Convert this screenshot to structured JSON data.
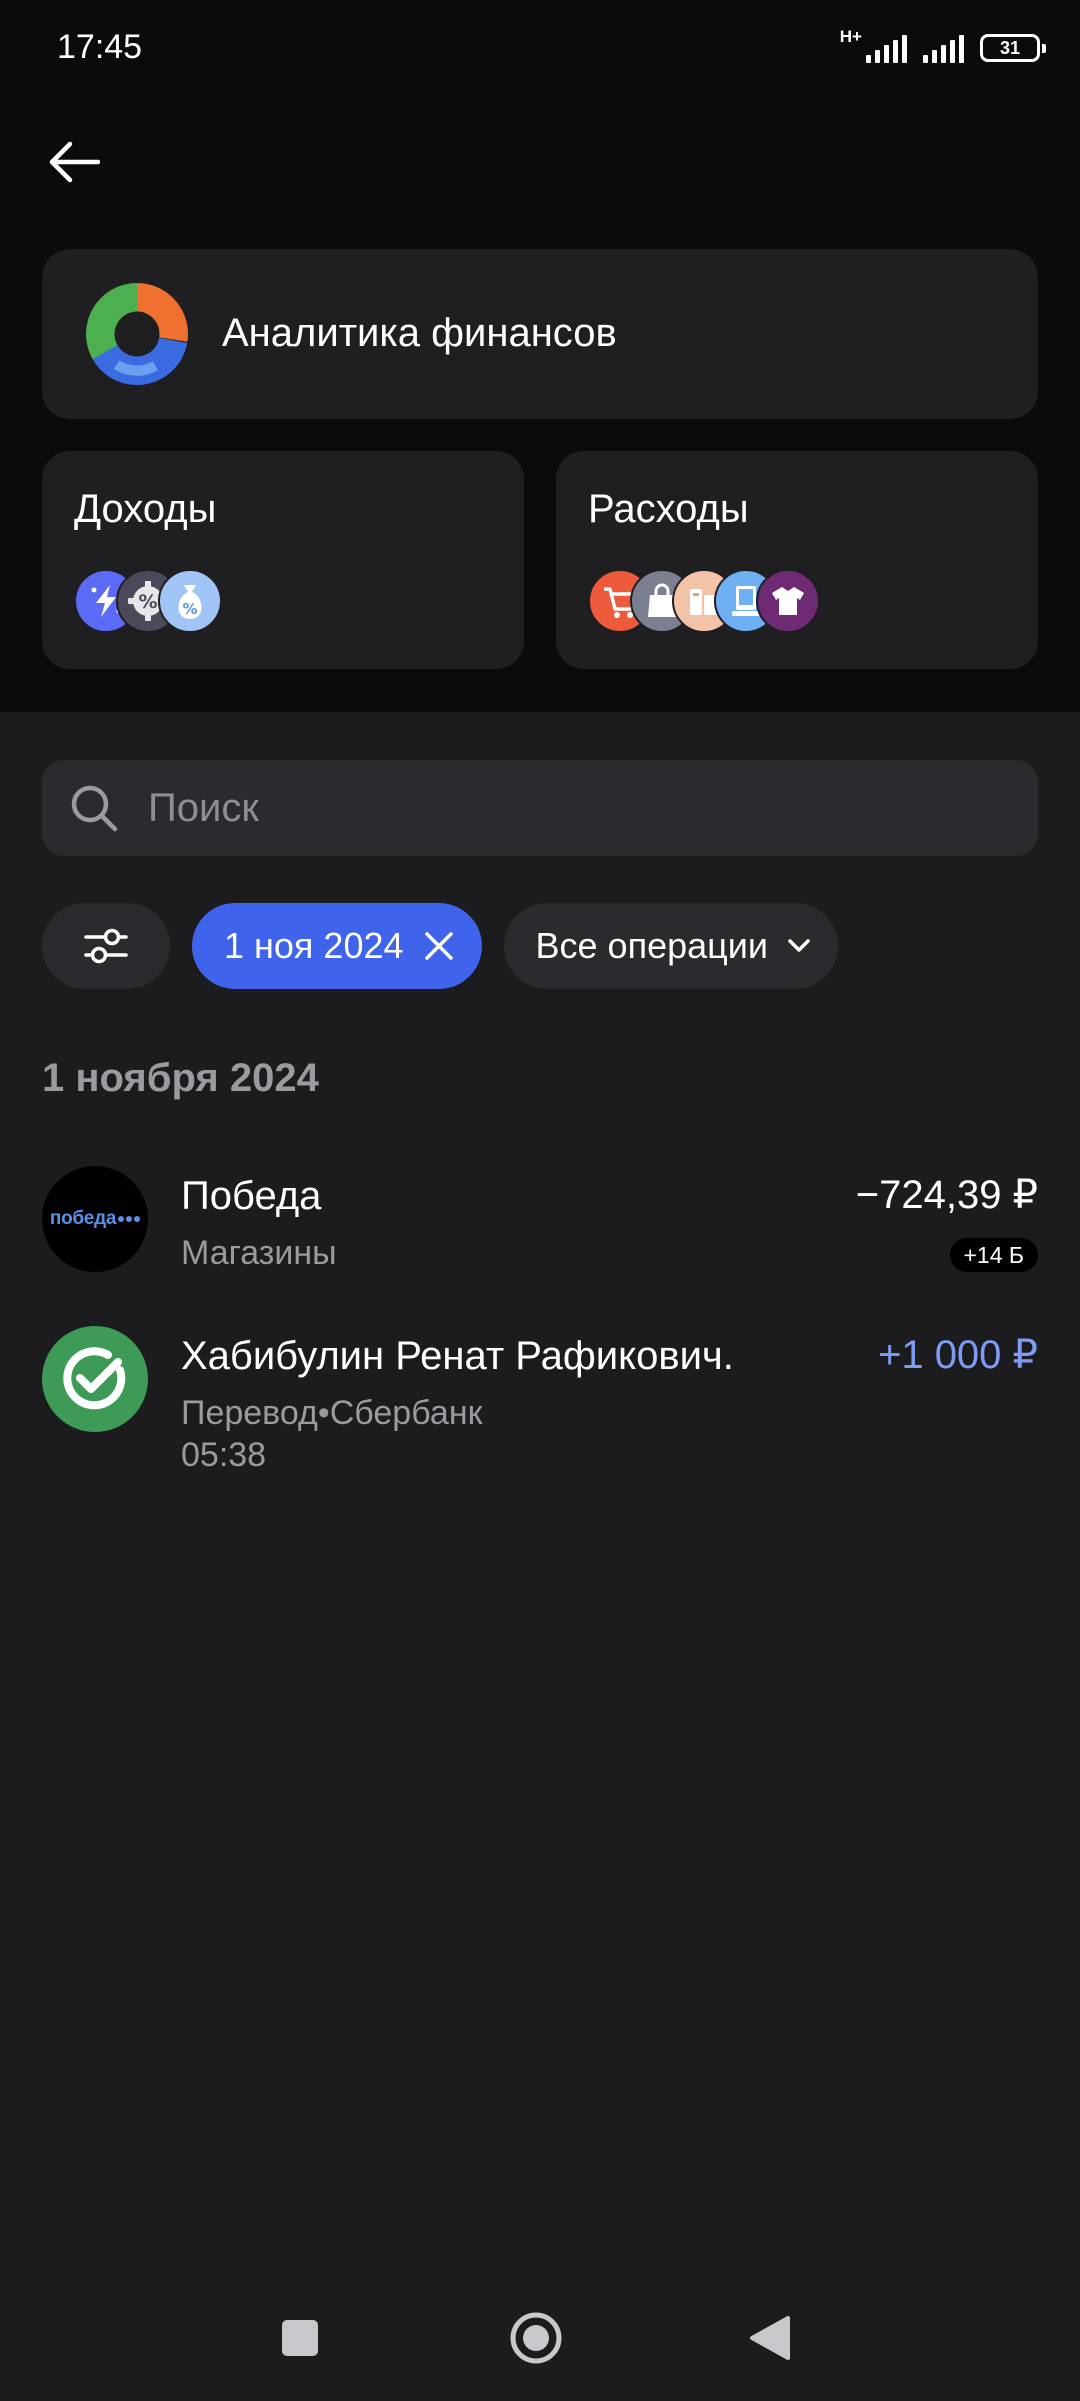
{
  "status_bar": {
    "time": "17:45",
    "network_type": "H+",
    "battery_level": "31",
    "icons": [
      "signal-icon",
      "signal-icon",
      "battery-icon"
    ]
  },
  "header": {
    "back_icon": "arrow-left-icon"
  },
  "analytics": {
    "title": "Аналитика финансов",
    "icon": "donut-chart-icon"
  },
  "income": {
    "title": "Доходы",
    "category_icons": [
      "cashback-icon",
      "percent-gear-icon",
      "money-bag-icon"
    ],
    "category_colors": [
      "#5b6bf5",
      "#4a4a5a",
      "#9fc4f5"
    ]
  },
  "expenses": {
    "title": "Расходы",
    "category_icons": [
      "shopping-cart-icon",
      "shopping-bag-icon",
      "marketplace-icon",
      "electronics-icon",
      "clothing-icon"
    ],
    "category_colors": [
      "#ee5a3c",
      "#7c7f8f",
      "#f2c3a6",
      "#6fb0f4",
      "#6e2a73"
    ]
  },
  "search": {
    "placeholder": "Поиск"
  },
  "filters": {
    "settings_icon": "sliders-icon",
    "date_chip": "1 ноя 2024",
    "date_chip_clear_icon": "close-icon",
    "operations_chip": "Все операции",
    "operations_icon": "chevron-down-icon",
    "active_chip_color": "#3f63ea"
  },
  "section": {
    "date_heading": "1 ноября 2024"
  },
  "transactions": [
    {
      "name": "Победа",
      "subtitle": "Магазины",
      "amount": "−724,39 ₽",
      "bonus": "+14 Б",
      "logo_text": "победа"
    },
    {
      "name": "Хабибулин Ренат Рафикович.",
      "subtitle": "Перевод•Сбербанк",
      "time": "05:38",
      "amount": "+1 000 ₽",
      "amount_color": "#7f9cf5"
    }
  ],
  "nav": {
    "recents_icon": "square-icon",
    "home_icon": "circle-icon",
    "back_icon": "triangle-back-icon"
  }
}
